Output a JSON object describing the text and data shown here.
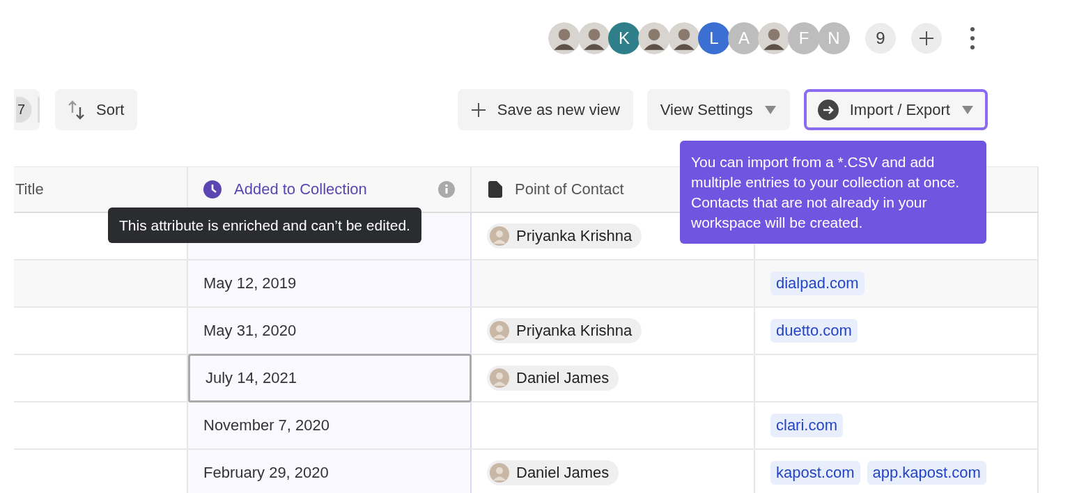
{
  "members": [
    {
      "kind": "photo"
    },
    {
      "kind": "photo"
    },
    {
      "kind": "letter",
      "initial": "K",
      "color": "#2f7f8a"
    },
    {
      "kind": "photo"
    },
    {
      "kind": "photo"
    },
    {
      "kind": "letter",
      "initial": "L",
      "color": "#3b6fd1"
    },
    {
      "kind": "letter",
      "initial": "A",
      "color": "#bdbdbd"
    },
    {
      "kind": "photo"
    },
    {
      "kind": "letter",
      "initial": "F",
      "color": "#bdbdbd"
    },
    {
      "kind": "letter",
      "initial": "N",
      "color": "#bdbdbd"
    }
  ],
  "member_overflow": "9",
  "toolbar": {
    "left": [
      {
        "kind": "count",
        "count": "7"
      },
      {
        "kind": "sort",
        "label": "Sort"
      }
    ],
    "right": [
      {
        "kind": "add",
        "label": "Save as new view",
        "selected": false
      },
      {
        "kind": "dropdown",
        "label": "View Settings",
        "selected": false
      },
      {
        "kind": "import",
        "label": "Import / Export",
        "selected": true
      }
    ]
  },
  "import_tooltip": "You can import from a *.CSV and add multiple entries to your collection at once. Contacts that are not already in your workspace will be created.",
  "enriched_tooltip": "This attribute is enriched and can’t be edited.",
  "table": {
    "columns": [
      {
        "kind": "text",
        "title": "Title",
        "enriched": false
      },
      {
        "kind": "date",
        "title": "Added to Collection",
        "enriched": true
      },
      {
        "kind": "person",
        "title": "Point of Contact",
        "enriched": false
      },
      {
        "kind": "domain",
        "enriched": false
      }
    ],
    "rows": [
      {
        "added": "",
        "contact": "Priyanka Krishna",
        "domains": [],
        "hovered": false,
        "cell_selected": false
      },
      {
        "added": "May 12, 2019",
        "contact": "",
        "domains": [
          "dialpad.com"
        ],
        "hovered": true,
        "cell_selected": false
      },
      {
        "added": "May 31, 2020",
        "contact": "Priyanka Krishna",
        "domains": [
          "duetto.com"
        ],
        "hovered": false,
        "cell_selected": false
      },
      {
        "added": "July 14, 2021",
        "contact": "Daniel James",
        "domains": [],
        "hovered": false,
        "cell_selected": true
      },
      {
        "added": "November 7, 2020",
        "contact": "",
        "domains": [
          "clari.com"
        ],
        "hovered": false,
        "cell_selected": false
      },
      {
        "added": "February 29, 2020",
        "contact": "Daniel James",
        "domains": [
          "kapost.com",
          "app.kapost.com"
        ],
        "hovered": false,
        "cell_selected": false
      }
    ]
  }
}
